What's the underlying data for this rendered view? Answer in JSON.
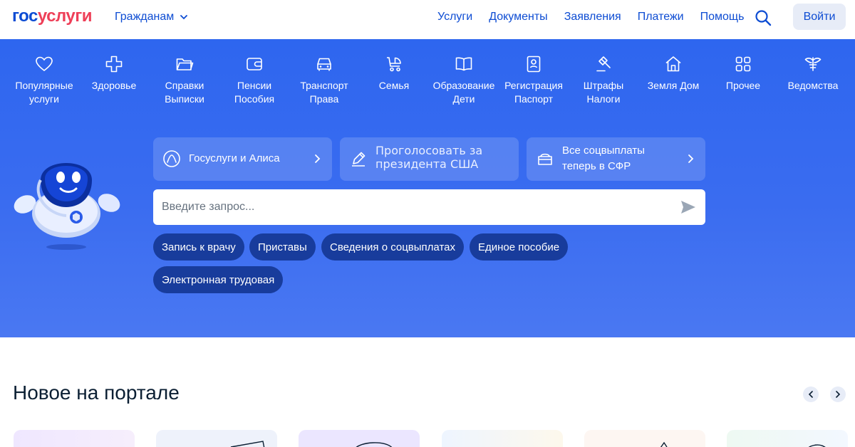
{
  "header": {
    "logo_part1": "гос",
    "logo_part2": "услуги",
    "role_selector": "Гражданам",
    "nav": [
      "Услуги",
      "Документы",
      "Заявления",
      "Платежи",
      "Помощь"
    ],
    "login": "Войти"
  },
  "categories": [
    {
      "icon": "heart-icon",
      "label": "Популярные услуги"
    },
    {
      "icon": "health-cross-icon",
      "label": "Здоровье"
    },
    {
      "icon": "folder-icon",
      "label": "Справки Выписки"
    },
    {
      "icon": "wallet-icon",
      "label": "Пенсии Пособия"
    },
    {
      "icon": "car-icon",
      "label": "Транспорт Права"
    },
    {
      "icon": "stroller-icon",
      "label": "Семья"
    },
    {
      "icon": "book-icon",
      "label": "Образование Дети"
    },
    {
      "icon": "passport-icon",
      "label": "Регистрация Паспорт"
    },
    {
      "icon": "gavel-icon",
      "label": "Штрафы Налоги"
    },
    {
      "icon": "house-icon",
      "label": "Земля Дом"
    },
    {
      "icon": "grid-icon",
      "label": "Прочее"
    },
    {
      "icon": "emblem-icon",
      "label": "Ведомства"
    }
  ],
  "promo_cards": {
    "alice": "Госуслуги и Алиса",
    "vote_line1": "Проголосовать за",
    "vote_line2": "президента США",
    "sfr_line1": "Все соцвыплаты",
    "sfr_line2": "теперь в СФР"
  },
  "search": {
    "placeholder": "Введите запрос..."
  },
  "chips": [
    "Запись к врачу",
    "Приставы",
    "Сведения о соцвыплатах",
    "Единое пособие",
    "Электронная трудовая"
  ],
  "news": {
    "title": "Новое на портале"
  },
  "colors": {
    "brand_blue": "#0d4cd3",
    "brand_red": "#ee3f58",
    "hero": "#3a6cf0",
    "chip": "#183c9c",
    "annotation": "#e1001a"
  }
}
